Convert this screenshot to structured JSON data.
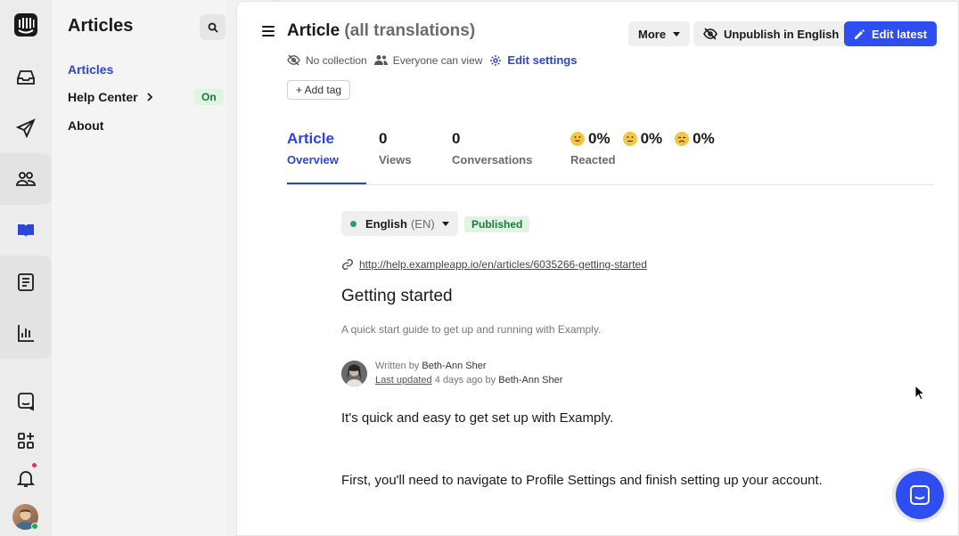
{
  "rail": {
    "items": [
      {
        "icon": "inbox-icon"
      },
      {
        "icon": "paper-plane-icon"
      },
      {
        "icon": "contacts-icon"
      },
      {
        "icon": "book-icon"
      },
      {
        "icon": "news-icon"
      },
      {
        "icon": "bar-chart-icon"
      },
      {
        "icon": "chat-icon"
      },
      {
        "icon": "apps-icon"
      },
      {
        "icon": "bell-icon"
      }
    ],
    "active_color": "#2b45d8"
  },
  "sidebar": {
    "title": "Articles",
    "items": [
      {
        "label": "Articles"
      },
      {
        "label": "Help Center",
        "badge": "On"
      },
      {
        "label": "About"
      }
    ]
  },
  "header": {
    "title": "Article",
    "title_suffix": "(all translations)",
    "more_label": "More",
    "unpublish_label": "Unpublish in English",
    "edit_label": "Edit latest"
  },
  "meta": {
    "collection": "No collection",
    "visibility": "Everyone can view",
    "settings_link": "Edit settings",
    "add_tag": "+ Add tag"
  },
  "stats": {
    "overview": {
      "top": "Article",
      "bottom": "Overview"
    },
    "views": {
      "value": "0",
      "label": "Views"
    },
    "conversations": {
      "value": "0",
      "label": "Conversations"
    },
    "reactions": {
      "happy": "0%",
      "neutral": "0%",
      "sad": "0%",
      "label": "Reacted"
    }
  },
  "article": {
    "language": "English",
    "language_code": "(EN)",
    "status": "Published",
    "url": "http://help.exampleapp.io/en/articles/6035266-getting-started",
    "title": "Getting started",
    "description": "A quick start guide to get up and running with Examply.",
    "written_by_prefix": "Written by",
    "author": "Beth-Ann Sher",
    "last_updated_label": "Last updated",
    "last_updated_value": "4 days ago by",
    "updated_by": "Beth-Ann Sher",
    "paragraph_1": "It's quick and easy to get set up with Examply.",
    "paragraph_2": "First, you'll need to navigate to Profile Settings and finish setting up your account."
  },
  "colors": {
    "accent": "#2e4df2",
    "published_bg": "#dff4e2",
    "published_text": "#1c7a3a"
  }
}
